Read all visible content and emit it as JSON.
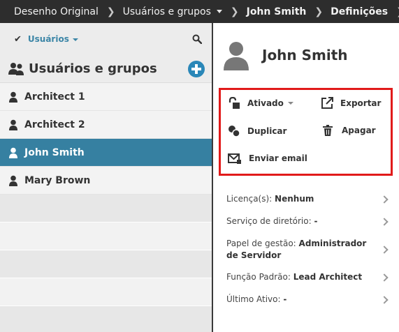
{
  "breadcrumb": {
    "items": [
      "Desenho Original",
      "Usuários e grupos",
      "John Smith",
      "Definições"
    ]
  },
  "left": {
    "filter_label": "Usuários",
    "group_title": "Usuários e grupos",
    "users": [
      {
        "label": "Architect 1"
      },
      {
        "label": "Architect 2"
      },
      {
        "label": "John Smith"
      },
      {
        "label": "Mary Brown"
      }
    ],
    "selected_index": 2
  },
  "right": {
    "name": "John Smith",
    "actions": {
      "status": "Ativado",
      "export": "Exportar",
      "duplicate": "Duplicar",
      "delete": "Apagar",
      "email": "Enviar email"
    },
    "details": [
      {
        "label": "Licença(s):",
        "value": "Nenhum"
      },
      {
        "label": "Serviço de diretório:",
        "value": "-"
      },
      {
        "label": "Papel de gestão:",
        "value": "Administrador de Servidor"
      },
      {
        "label": "Função Padrão:",
        "value": "Lead Architect"
      },
      {
        "label": "Último Ativo:",
        "value": "-"
      }
    ]
  },
  "colors": {
    "topbar": "#2d2d2d",
    "accent": "#3680a1",
    "add_button": "#2a87b8",
    "highlight_border": "#e11a1a"
  },
  "icons": {
    "check": "check-icon",
    "search": "search-icon",
    "group": "users-group-icon",
    "add": "plus-circle-icon",
    "user": "user-icon",
    "status": "unlock-icon",
    "export": "external-link-icon",
    "duplicate": "duplicate-icon",
    "delete": "trash-icon",
    "email": "email-icon"
  }
}
